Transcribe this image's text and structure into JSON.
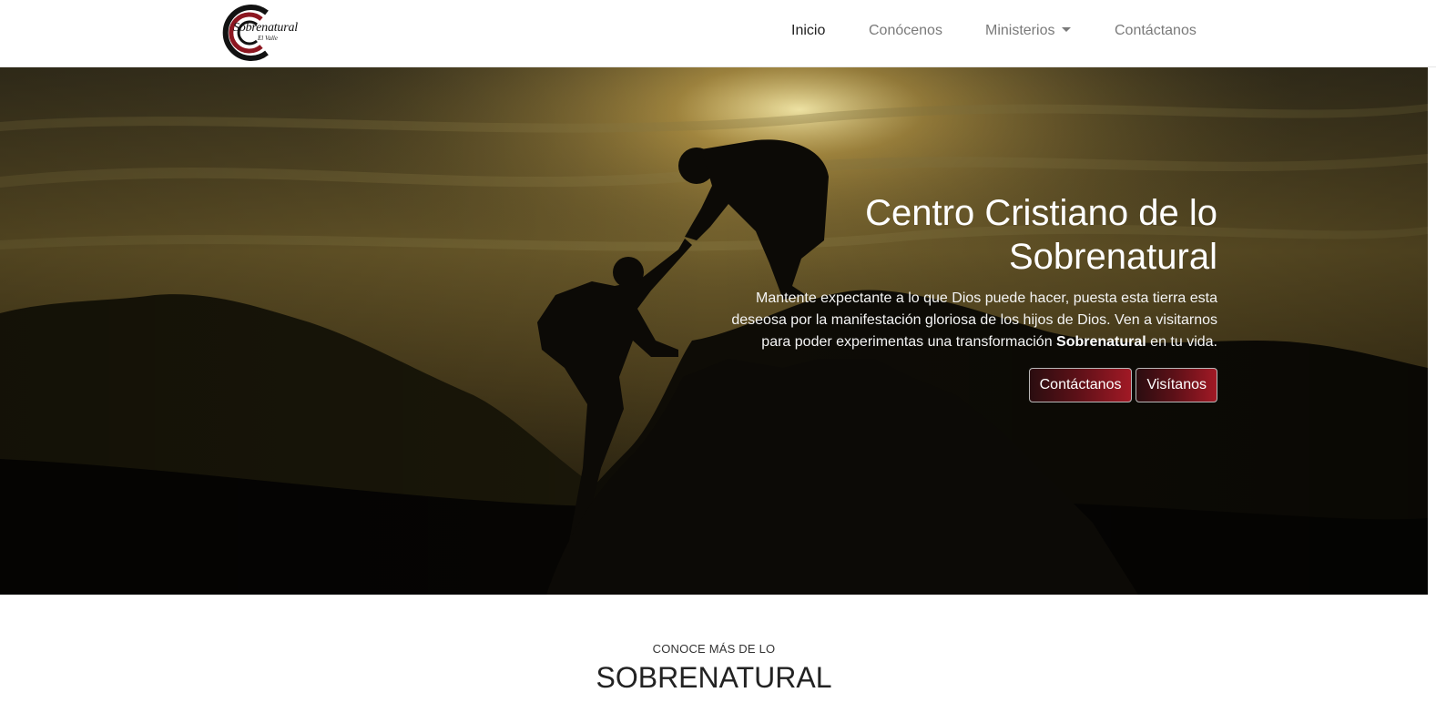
{
  "brand": {
    "logo_text": "Sobrenatural",
    "logo_subtext": "El Valle"
  },
  "nav": {
    "items": [
      {
        "label": "Inicio",
        "active": true
      },
      {
        "label": "Conócenos",
        "active": false
      },
      {
        "label": "Ministerios",
        "active": false,
        "dropdown": true
      },
      {
        "label": "Contáctanos",
        "active": false
      }
    ]
  },
  "hero": {
    "title_line1": "Centro Cristiano de lo",
    "title_line2": "Sobrenatural",
    "text_before": "Mantente expectante a lo que Dios puede hacer, puesta esta tierra esta deseosa por la manifestación gloriosa de los hijos de Dios. Ven a visitarnos para poder experimentas una transformación ",
    "text_bold": "Sobrenatural",
    "text_after": " en tu vida.",
    "buttons": {
      "contact": "Contáctanos",
      "visit": "Visítanos"
    }
  },
  "section": {
    "kicker": "CONOCE MÁS DE LO",
    "title": "SOBRENATURAL"
  },
  "colors": {
    "brand_red": "#a11925",
    "nav_active": "#1f1f1f",
    "nav_inactive": "#7a7a7a"
  }
}
